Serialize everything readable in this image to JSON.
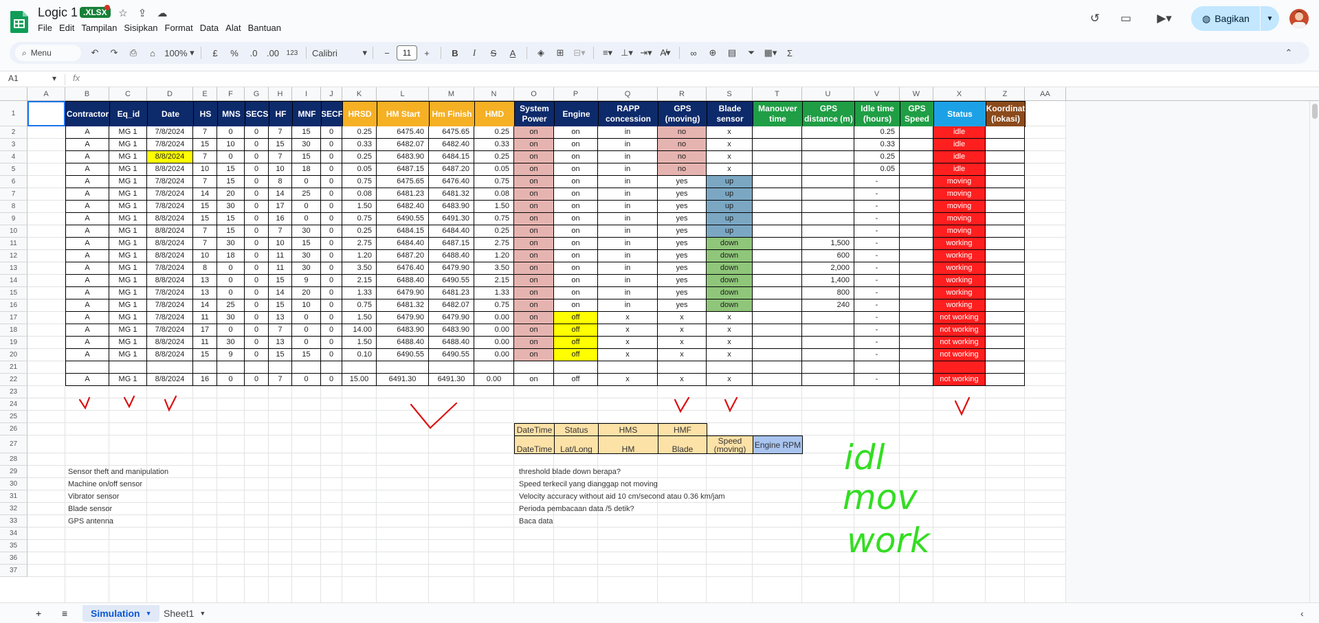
{
  "app": {
    "doc_title": "Logic 1",
    "file_badge": ".XLSX",
    "menus": [
      "File",
      "Edit",
      "Tampilan",
      "Sisipkan",
      "Format",
      "Data",
      "Alat",
      "Bantuan"
    ],
    "share_label": "Bagikan",
    "accent": "#c2e7ff"
  },
  "toolbar": {
    "menu_search": "Menu",
    "zoom": "100%",
    "currency": "£",
    "percent": "%",
    "dec_dec": ".0",
    "dec_inc": ".00",
    "num_format": "123",
    "font": "Calibri",
    "font_size": "11",
    "bold": "B",
    "italic": "I",
    "sum": "Σ"
  },
  "formula_bar": {
    "name_box": "A1",
    "fx": "fx",
    "value": ""
  },
  "columns": [
    "A",
    "B",
    "C",
    "D",
    "E",
    "F",
    "G",
    "H",
    "I",
    "J",
    "K",
    "L",
    "M",
    "N",
    "O",
    "P",
    "Q",
    "R",
    "S",
    "T",
    "U",
    "V",
    "W",
    "X",
    "Z",
    "AA"
  ],
  "rows": [
    "1",
    "2",
    "3",
    "4",
    "5",
    "6",
    "7",
    "8",
    "9",
    "10",
    "11",
    "12",
    "13",
    "14",
    "15",
    "16",
    "17",
    "18",
    "19",
    "20",
    "21",
    "22",
    "23",
    "24",
    "25",
    "26",
    "27",
    "28",
    "29",
    "30",
    "31",
    "32",
    "33",
    "34",
    "35",
    "36",
    "37"
  ],
  "headers": [
    "Contractor",
    "Eq_id",
    "Date",
    "HS",
    "MNS",
    "SECS",
    "HF",
    "MNF",
    "SECF",
    "HRSD",
    "HM Start",
    "Hm Finish",
    "HMD",
    "System Power",
    "Engine",
    "RAPP concession",
    "GPS (moving)",
    "Blade sensor",
    "Manouver time",
    "GPS distance (m)",
    "Idle time (hours)",
    "GPS Speed",
    "Status",
    "Koordinat (lokasi)"
  ],
  "data_rows": [
    [
      "A",
      "MG 1",
      "7/8/2024",
      "7",
      "0",
      "0",
      "7",
      "15",
      "0",
      "0.25",
      "6475.40",
      "6475.65",
      "0.25",
      "on",
      "on",
      "in",
      "no",
      "x",
      "",
      "",
      "0.25",
      "",
      "idle",
      ""
    ],
    [
      "A",
      "MG 1",
      "7/8/2024",
      "15",
      "10",
      "0",
      "15",
      "30",
      "0",
      "0.33",
      "6482.07",
      "6482.40",
      "0.33",
      "on",
      "on",
      "in",
      "no",
      "x",
      "",
      "",
      "0.33",
      "",
      "idle",
      ""
    ],
    [
      "A",
      "MG 1",
      "8/8/2024",
      "7",
      "0",
      "0",
      "7",
      "15",
      "0",
      "0.25",
      "6483.90",
      "6484.15",
      "0.25",
      "on",
      "on",
      "in",
      "no",
      "x",
      "",
      "",
      "0.25",
      "",
      "idle",
      ""
    ],
    [
      "A",
      "MG 1",
      "8/8/2024",
      "10",
      "15",
      "0",
      "10",
      "18",
      "0",
      "0.05",
      "6487.15",
      "6487.20",
      "0.05",
      "on",
      "on",
      "in",
      "no",
      "x",
      "",
      "",
      "0.05",
      "",
      "idle",
      ""
    ],
    [
      "A",
      "MG 1",
      "7/8/2024",
      "7",
      "15",
      "0",
      "8",
      "0",
      "0",
      "0.75",
      "6475.65",
      "6476.40",
      "0.75",
      "on",
      "on",
      "in",
      "yes",
      "up",
      "",
      "",
      "-",
      "",
      "moving",
      ""
    ],
    [
      "A",
      "MG 1",
      "7/8/2024",
      "14",
      "20",
      "0",
      "14",
      "25",
      "0",
      "0.08",
      "6481.23",
      "6481.32",
      "0.08",
      "on",
      "on",
      "in",
      "yes",
      "up",
      "",
      "",
      "-",
      "",
      "moving",
      ""
    ],
    [
      "A",
      "MG 1",
      "7/8/2024",
      "15",
      "30",
      "0",
      "17",
      "0",
      "0",
      "1.50",
      "6482.40",
      "6483.90",
      "1.50",
      "on",
      "on",
      "in",
      "yes",
      "up",
      "",
      "",
      "-",
      "",
      "moving",
      ""
    ],
    [
      "A",
      "MG 1",
      "8/8/2024",
      "15",
      "15",
      "0",
      "16",
      "0",
      "0",
      "0.75",
      "6490.55",
      "6491.30",
      "0.75",
      "on",
      "on",
      "in",
      "yes",
      "up",
      "",
      "",
      "-",
      "",
      "moving",
      ""
    ],
    [
      "A",
      "MG 1",
      "8/8/2024",
      "7",
      "15",
      "0",
      "7",
      "30",
      "0",
      "0.25",
      "6484.15",
      "6484.40",
      "0.25",
      "on",
      "on",
      "in",
      "yes",
      "up",
      "",
      "",
      "-",
      "",
      "moving",
      ""
    ],
    [
      "A",
      "MG 1",
      "8/8/2024",
      "7",
      "30",
      "0",
      "10",
      "15",
      "0",
      "2.75",
      "6484.40",
      "6487.15",
      "2.75",
      "on",
      "on",
      "in",
      "yes",
      "down",
      "",
      "1,500",
      "-",
      "",
      "working",
      ""
    ],
    [
      "A",
      "MG 1",
      "8/8/2024",
      "10",
      "18",
      "0",
      "11",
      "30",
      "0",
      "1.20",
      "6487.20",
      "6488.40",
      "1.20",
      "on",
      "on",
      "in",
      "yes",
      "down",
      "",
      "600",
      "-",
      "",
      "working",
      ""
    ],
    [
      "A",
      "MG 1",
      "7/8/2024",
      "8",
      "0",
      "0",
      "11",
      "30",
      "0",
      "3.50",
      "6476.40",
      "6479.90",
      "3.50",
      "on",
      "on",
      "in",
      "yes",
      "down",
      "",
      "2,000",
      "-",
      "",
      "working",
      ""
    ],
    [
      "A",
      "MG 1",
      "8/8/2024",
      "13",
      "0",
      "0",
      "15",
      "9",
      "0",
      "2.15",
      "6488.40",
      "6490.55",
      "2.15",
      "on",
      "on",
      "in",
      "yes",
      "down",
      "",
      "1,400",
      "-",
      "",
      "working",
      ""
    ],
    [
      "A",
      "MG 1",
      "7/8/2024",
      "13",
      "0",
      "0",
      "14",
      "20",
      "0",
      "1.33",
      "6479.90",
      "6481.23",
      "1.33",
      "on",
      "on",
      "in",
      "yes",
      "down",
      "",
      "800",
      "-",
      "",
      "working",
      ""
    ],
    [
      "A",
      "MG 1",
      "7/8/2024",
      "14",
      "25",
      "0",
      "15",
      "10",
      "0",
      "0.75",
      "6481.32",
      "6482.07",
      "0.75",
      "on",
      "on",
      "in",
      "yes",
      "down",
      "",
      "240",
      "-",
      "",
      "working",
      ""
    ],
    [
      "A",
      "MG 1",
      "7/8/2024",
      "11",
      "30",
      "0",
      "13",
      "0",
      "0",
      "1.50",
      "6479.90",
      "6479.90",
      "0.00",
      "on",
      "off",
      "x",
      "x",
      "x",
      "",
      "",
      "-",
      "",
      "not working",
      ""
    ],
    [
      "A",
      "MG 1",
      "7/8/2024",
      "17",
      "0",
      "0",
      "7",
      "0",
      "0",
      "14.00",
      "6483.90",
      "6483.90",
      "0.00",
      "on",
      "off",
      "x",
      "x",
      "x",
      "",
      "",
      "-",
      "",
      "not working",
      ""
    ],
    [
      "A",
      "MG 1",
      "8/8/2024",
      "11",
      "30",
      "0",
      "13",
      "0",
      "0",
      "1.50",
      "6488.40",
      "6488.40",
      "0.00",
      "on",
      "off",
      "x",
      "x",
      "x",
      "",
      "",
      "-",
      "",
      "not working",
      ""
    ],
    [
      "A",
      "MG 1",
      "8/8/2024",
      "15",
      "9",
      "0",
      "15",
      "15",
      "0",
      "0.10",
      "6490.55",
      "6490.55",
      "0.00",
      "on",
      "off",
      "x",
      "x",
      "x",
      "",
      "",
      "-",
      "",
      "not working",
      ""
    ],
    [
      "",
      "",
      "",
      "",
      "",
      "",
      "",
      "",
      "",
      "",
      "",
      "",
      "",
      "",
      "",
      "",
      "",
      "",
      "",
      "",
      "",
      "",
      "",
      ""
    ],
    [
      "A",
      "MG 1",
      "8/8/2024",
      "16",
      "0",
      "0",
      "7",
      "0",
      "0",
      "15.00",
      "6491.30",
      "6491.30",
      "0.00",
      "on",
      "off",
      "x",
      "x",
      "x",
      "",
      "",
      "-",
      "",
      "not working",
      ""
    ]
  ],
  "legend": {
    "row1": [
      "DateTime",
      "Status",
      "HMS",
      "HMF"
    ],
    "row2": [
      "DateTime",
      "Lat/Long",
      "HM",
      "Blade",
      "Speed (moving)",
      "Engine RPM"
    ]
  },
  "notes_left": [
    "Sensor theft and manipulation",
    "Machine on/off sensor",
    "Vibrator sensor",
    "Blade sensor",
    "GPS antenna"
  ],
  "notes_mid": [
    "threshold blade down berapa?",
    "Speed terkecil yang dianggap not moving",
    "Velocity accuracy without aid 10 cm/second atau 0.36 km/jam",
    "Perioda pembacaan data  /5 detik?",
    "Baca data"
  ],
  "handwriting": [
    "idl",
    "mov",
    "work"
  ],
  "sheets": [
    "Simulation",
    "Sheet1"
  ],
  "colors": {
    "navy": "#0d2a6b",
    "orange": "#f6b024",
    "green": "#1f9e45",
    "blue_header": "#1da1e6",
    "brown": "#8b4a1b",
    "pink": "#e6b4b0",
    "yellow": "#ffff00",
    "red_status": "#ff1f1f",
    "blade_up": "#7ba7c3",
    "blade_down": "#8fc67a",
    "legend_fill": "#fde2a8",
    "legend_blue": "#a8c4ef"
  }
}
